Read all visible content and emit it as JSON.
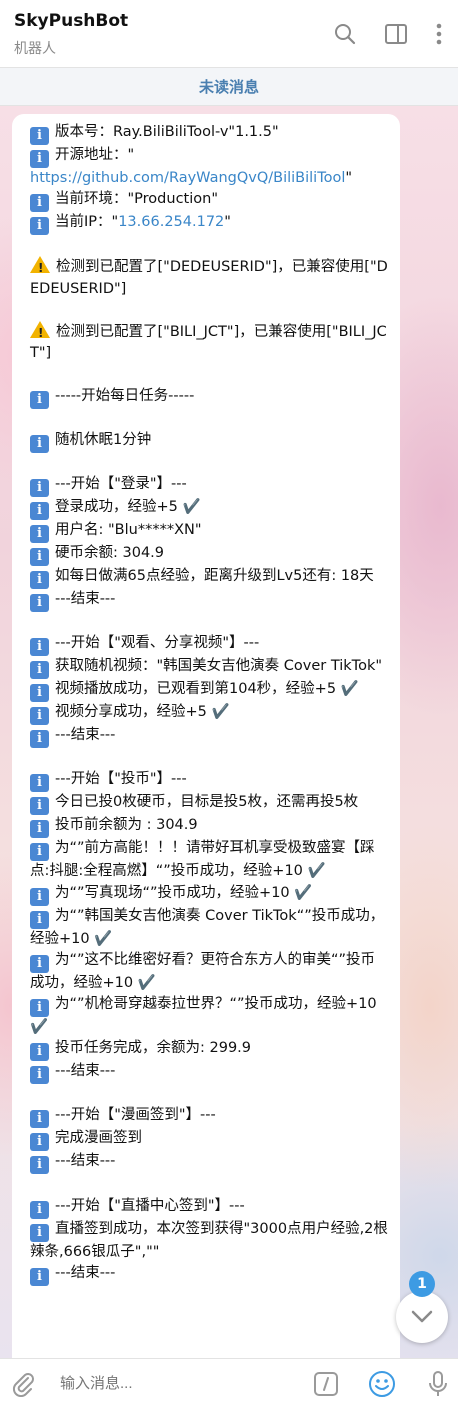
{
  "header": {
    "title": "SkyPushBot",
    "subtitle": "机器人"
  },
  "unread_bar": "未读消息",
  "message": {
    "l01": "版本号：Ray.BiliBiliTool-v\"1.1.5\"",
    "l02": "开源地址：\"",
    "l03": "https://github.com/RayWangQvQ/BiliBiliTool",
    "l03b": "\"",
    "l04": "当前环境：\"Production\"",
    "l05a": "当前IP：\"",
    "l05b": "13.66.254.172",
    "l05c": "\"",
    "l06": "检测到已配置了[\"DEDEUSERID\"]，已兼容使用[\"DEDEUSERID\"]",
    "l07": "检测到已配置了[\"BILI_JCT\"]，已兼容使用[\"BILI_JCT\"]",
    "l08": "-----开始每日任务-----",
    "l09": "随机休眠1分钟",
    "l10": "---开始【\"登录\"】---",
    "l11": "登录成功，经验+5",
    "l12": "用户名: \"Blu*****XN\"",
    "l13": "硬币余额: 304.9",
    "l14": "如每日做满65点经验，距离升级到Lv5还有: 18天",
    "l15": "---结束---",
    "l16": "---开始【\"观看、分享视频\"】---",
    "l17": "获取随机视频：\"韩国美女吉他演奏 Cover TikTok\"",
    "l18": "视频播放成功，已观看到第104秒，经验+5",
    "l19": "视频分享成功，经验+5",
    "l20": "---结束---",
    "l21": "---开始【\"投币\"】---",
    "l22": "今日已投0枚硬币，目标是投5枚，还需再投5枚",
    "l23": "投币前余额为 : 304.9",
    "l24": "为“”前方高能！！！请带好耳机享受极致盛宴【踩点:抖腿:全程高燃】“”投币成功，经验+10",
    "l25": "为“”写真现场“”投币成功，经验+10",
    "l26": "为“”韩国美女吉他演奏 Cover TikTok“”投币成功，经验+10",
    "l27": "为“”这不比维密好看？更符合东方人的审美“”投币成功，经验+10",
    "l28": "为“”机枪哥穿越泰拉世界？“”投币成功，经验+10",
    "l29": "投币任务完成，余额为: 299.9",
    "l30": "---结束---",
    "l31": "---开始【\"漫画签到\"】---",
    "l32": "完成漫画签到",
    "l33": "---结束---",
    "l34": "---开始【\"直播中心签到\"】---",
    "l35": "直播签到成功，本次签到获得\"3000点用户经验,2根辣条,666银瓜子\",\"\"",
    "l36": "---结束---",
    "check": "✔️"
  },
  "unread_count": "1",
  "footer": {
    "placeholder": "输入消息..."
  },
  "icons": {
    "search": "search-icon",
    "sidebar": "sidebar-toggle-icon",
    "more": "more-vertical-icon",
    "attach": "paperclip-icon",
    "commands": "slash-command-icon",
    "emoji": "emoji-icon",
    "mic": "microphone-icon",
    "scroll": "chevron-down-icon"
  },
  "colors": {
    "accent": "#3d9be3",
    "link": "#3a86c8",
    "info_icon": "#4a87d3"
  }
}
